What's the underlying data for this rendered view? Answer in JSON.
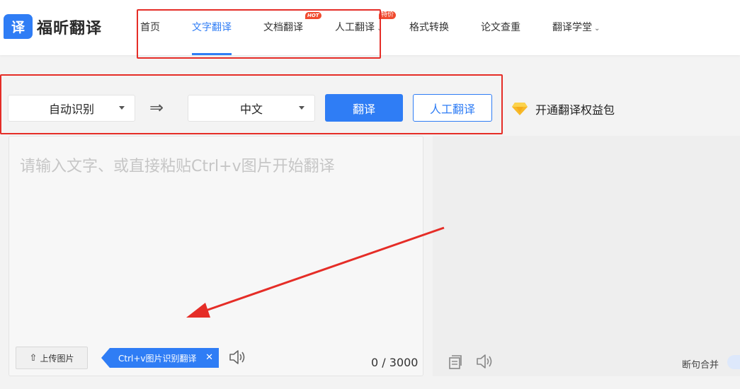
{
  "brand": {
    "logo_char": "译",
    "name": "福昕翻译"
  },
  "nav": {
    "items": [
      {
        "label": "首页"
      },
      {
        "label": "文字翻译"
      },
      {
        "label": "文档翻译",
        "badge": "HOT"
      },
      {
        "label": "人工翻译",
        "badge": "特价"
      },
      {
        "label": "格式转换"
      },
      {
        "label": "论文查重"
      },
      {
        "label": "翻译学堂"
      }
    ],
    "active_index": 1
  },
  "translate_bar": {
    "source_lang": "自动识别",
    "swap_symbol": "⇒",
    "target_lang": "中文",
    "translate_button": "翻译",
    "human_translate_button": "人工翻译",
    "vip_link": "开通翻译权益包"
  },
  "input_panel": {
    "placeholder": "请输入文字、或直接粘贴Ctrl+v图片开始翻译",
    "upload_button": "上传图片",
    "ocr_tip": "Ctrl+v图片识别翻译",
    "char_count": "0",
    "char_separator": "/",
    "char_limit": "3000"
  },
  "output_panel": {
    "merge_label": "断句合并"
  },
  "colors": {
    "accent": "#2f7df5",
    "annotation_red": "#e52d27",
    "badge_red": "#f04b2f"
  }
}
